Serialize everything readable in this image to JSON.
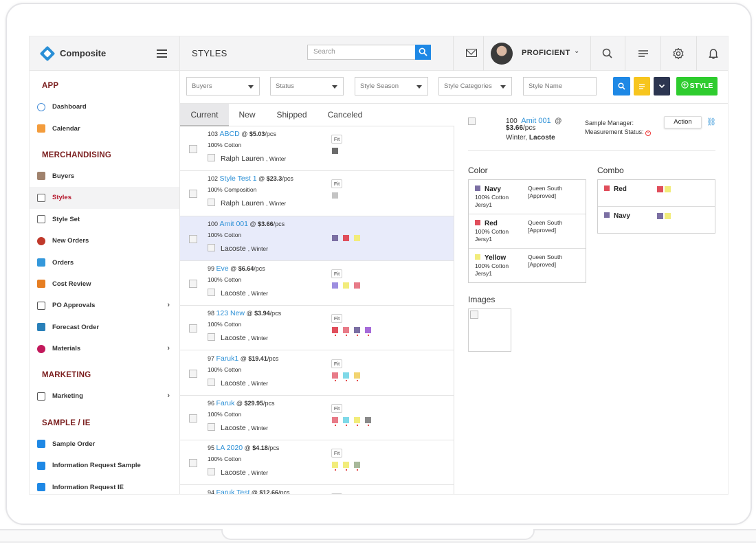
{
  "brand": {
    "name": "Composite"
  },
  "header": {
    "title": "STYLES",
    "search_placeholder": "Search",
    "user_name": "PROFICIENT"
  },
  "sidebar": {
    "sections": [
      {
        "title": "APP",
        "items": [
          {
            "label": "Dashboard",
            "icon": "dashboard-icon",
            "color": "#4a90d9"
          },
          {
            "label": "Calendar",
            "icon": "calendar-icon",
            "color": "#f39c3c"
          }
        ]
      },
      {
        "title": "MERCHANDISING",
        "items": [
          {
            "label": "Buyers",
            "icon": "buyer-icon",
            "color": "#a0826d"
          },
          {
            "label": "Styles",
            "icon": "shirt-icon",
            "color": "#666666",
            "active": true
          },
          {
            "label": "Style Set",
            "icon": "shirt-outline-icon",
            "color": "#666666"
          },
          {
            "label": "New Orders",
            "icon": "new-orders-icon",
            "color": "#c0392b"
          },
          {
            "label": "Orders",
            "icon": "orders-icon",
            "color": "#3498db"
          },
          {
            "label": "Cost Review",
            "icon": "cost-review-icon",
            "color": "#e67e22"
          },
          {
            "label": "PO Approvals",
            "icon": "po-approvals-icon",
            "color": "#555555",
            "chevron": true
          },
          {
            "label": "Forecast Order",
            "icon": "forecast-icon",
            "color": "#2980b9"
          },
          {
            "label": "Materials",
            "icon": "materials-icon",
            "color": "#c2185b",
            "chevron": true
          }
        ]
      },
      {
        "title": "MARKETING",
        "items": [
          {
            "label": "Marketing",
            "icon": "marketing-icon",
            "color": "#555555",
            "chevron": true
          }
        ]
      },
      {
        "title": "SAMPLE / IE",
        "items": [
          {
            "label": "Sample Order",
            "icon": "tshirt-icon",
            "color": "#1e88e5"
          },
          {
            "label": "Information Request Sample",
            "icon": "tshirt-icon",
            "color": "#1e88e5"
          },
          {
            "label": "Information Request IE",
            "icon": "tshirt-icon",
            "color": "#1e88e5"
          }
        ]
      }
    ]
  },
  "filters": {
    "buyers": "Buyers",
    "status": "Status",
    "style_season": "Style Season",
    "style_categories": "Style Categories",
    "style_name": "Style Name",
    "add_style_label": "STYLE"
  },
  "tabs": [
    "Current",
    "New",
    "Shipped",
    "Canceled"
  ],
  "styles": [
    {
      "num": "103",
      "name": "ABCD",
      "price": "$5.03",
      "unit": "/pcs",
      "material": "100% Cotton",
      "buyer": "Ralph Lauren",
      "season": ", Winter",
      "fit": "Fit",
      "swatches": [
        "#6b6b6b"
      ],
      "dots": false
    },
    {
      "num": "102",
      "name": "Style Test 1",
      "price": "$23.3",
      "unit": "/pcs",
      "material": "100% Composition",
      "buyer": "Ralph Lauren",
      "season": ", Winter",
      "fit": "Fit",
      "swatches": [
        "#c4c4c4"
      ],
      "dots": false
    },
    {
      "num": "100",
      "name": "Amit 001",
      "price": "$3.66",
      "unit": "/pcs",
      "material": "100% Cotton",
      "buyer": "Lacoste",
      "season": ", Winter",
      "fit": "",
      "swatches": [
        "#7b6fa3",
        "#e04e5b",
        "#f2ec7b"
      ],
      "dots": false,
      "selected": true
    },
    {
      "num": "99",
      "name": "Eve",
      "price": "$6.64",
      "unit": "/pcs",
      "material": "100% Cotton",
      "buyer": "Lacoste",
      "season": ", Winter",
      "fit": "Fit",
      "swatches": [
        "#9d8ee0",
        "#f2ec7b",
        "#e87b88"
      ],
      "dots": false
    },
    {
      "num": "98",
      "name": "123 New",
      "price": "$3.94",
      "unit": "/pcs",
      "material": "100% Cotton",
      "buyer": "Lacoste",
      "season": ", Winter",
      "fit": "Fit",
      "swatches": [
        "#e04e5b",
        "#e87b88",
        "#7b6fa3",
        "#a66bd9"
      ],
      "dots": true
    },
    {
      "num": "97",
      "name": "Faruk1",
      "price": "$19.41",
      "unit": "/pcs",
      "material": "100% Cotton",
      "buyer": "Lacoste",
      "season": ", Winter",
      "fit": "Fit",
      "swatches": [
        "#e87b88",
        "#7fd9e8",
        "#f2d470"
      ],
      "dots": true
    },
    {
      "num": "96",
      "name": "Faruk",
      "price": "$29.95",
      "unit": "/pcs",
      "material": "100% Cotton",
      "buyer": "Lacoste",
      "season": ", Winter",
      "fit": "Fit",
      "swatches": [
        "#e87b88",
        "#7fd9e8",
        "#f2ec7b",
        "#8a8a8a"
      ],
      "dots": true
    },
    {
      "num": "95",
      "name": "LA 2020",
      "price": "$4.18",
      "unit": "/pcs",
      "material": "100% Cotton",
      "buyer": "Lacoste",
      "season": ", Winter",
      "fit": "Fit",
      "swatches": [
        "#f2ec7b",
        "#f2ec7b",
        "#a8b89a"
      ],
      "dots": true
    },
    {
      "num": "94",
      "name": "Faruk Test",
      "price": "$12.66",
      "unit": "/pcs",
      "material": "",
      "buyer": "",
      "season": "",
      "fit": "Fit",
      "swatches": [],
      "dots": false
    }
  ],
  "detail": {
    "num": "100",
    "name": "Amit 001",
    "at": "@",
    "price": "$3.66",
    "unit": "/pcs",
    "season": "Winter,",
    "buyer": "Lacoste",
    "sample_manager_label": "Sample Manager:",
    "measurement_status_label": "Measurement Status:",
    "action_label": "Action",
    "color_title": "Color",
    "combo_title": "Combo",
    "images_title": "Images",
    "colors": [
      {
        "name": "Navy",
        "swatch": "#7b6fa3",
        "material": "100% Cotton",
        "fabric": "Jersy1",
        "supplier": "Queen South",
        "status": "[Approved]"
      },
      {
        "name": "Red",
        "swatch": "#e04e5b",
        "material": "100% Cotton",
        "fabric": "Jersy1",
        "supplier": "Queen South",
        "status": "[Approved]"
      },
      {
        "name": "Yellow",
        "swatch": "#f2ec7b",
        "material": "100% Cotton",
        "fabric": "Jersy1",
        "supplier": "Queen South",
        "status": "[Approved]"
      }
    ],
    "combos": [
      {
        "name": "Red",
        "swatch": "#e04e5b",
        "combo_swatches": [
          "#e04e5b",
          "#f2ec7b"
        ]
      },
      {
        "name": "Navy",
        "swatch": "#7b6fa3",
        "combo_swatches": [
          "#7b6fa3",
          "#f2ec7b"
        ]
      }
    ]
  }
}
